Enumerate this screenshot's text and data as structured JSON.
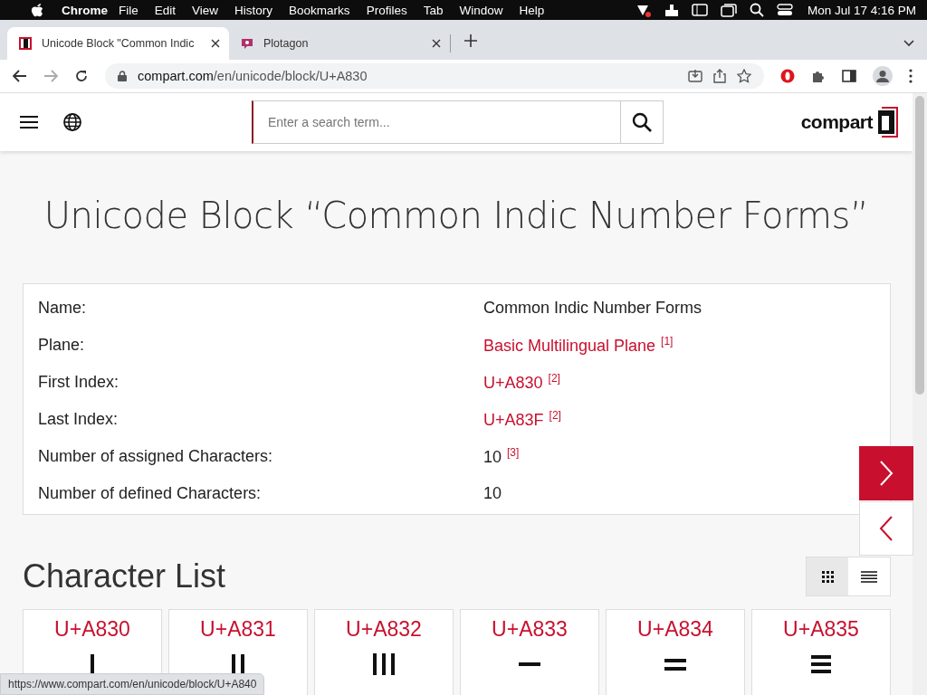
{
  "menu_bar": {
    "app": "Chrome",
    "items": [
      "File",
      "Edit",
      "View",
      "History",
      "Bookmarks",
      "Profiles",
      "Tab",
      "Window",
      "Help"
    ],
    "clock": "Mon Jul 17  4:16 PM"
  },
  "tabs": [
    {
      "title": "Unicode Block \"Common Indic",
      "selected": true
    },
    {
      "title": "Plotagon",
      "selected": false
    }
  ],
  "address_bar": {
    "host": "compart.com",
    "path": "/en/unicode/block/U+A830"
  },
  "header": {
    "search": {
      "placeholder": "Enter a search term..."
    },
    "logo": "compart"
  },
  "title": "Unicode Block “Common Indic Number Forms”",
  "info": [
    {
      "label": "Name:",
      "value": "Common Indic Number Forms",
      "link": false
    },
    {
      "label": "Plane:",
      "value": "Basic Multilingual Plane",
      "link": true,
      "note": "[1]"
    },
    {
      "label": "First Index:",
      "value": "U+A830",
      "link": true,
      "note": "[2]"
    },
    {
      "label": "Last Index:",
      "value": "U+A83F",
      "link": true,
      "note": "[2]"
    },
    {
      "label": "Number of assigned Characters:",
      "value": "10",
      "link": false,
      "note": "[3]"
    },
    {
      "label": "Number of defined Characters:",
      "value": "10",
      "link": false
    }
  ],
  "character_list": {
    "heading": "Character List",
    "views": [
      {
        "kind": "grid",
        "selected": true
      },
      {
        "kind": "list",
        "selected": false
      }
    ],
    "characters": [
      {
        "code": "U+A830",
        "kind": "bar1"
      },
      {
        "code": "U+A831",
        "kind": "bar2"
      },
      {
        "code": "U+A832",
        "kind": "bar3"
      },
      {
        "code": "U+A833",
        "kind": "dash1"
      },
      {
        "code": "U+A834",
        "kind": "dash2"
      },
      {
        "code": "U+A835",
        "kind": "dash3"
      }
    ]
  },
  "status_bar": "https://www.compart.com/en/unicode/block/U+A840"
}
